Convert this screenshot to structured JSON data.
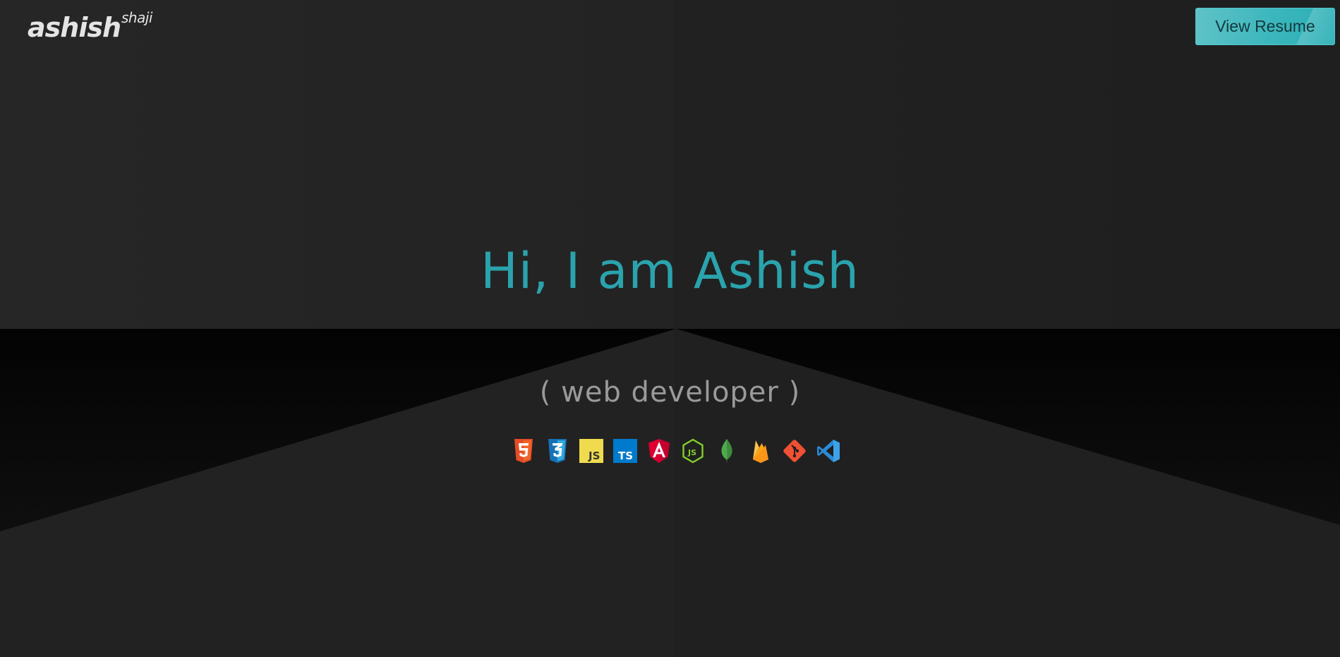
{
  "header": {
    "logo_main": "ashish",
    "logo_sup": "shaji",
    "resume_button_label": "View Resume"
  },
  "hero": {
    "headline": "Hi, I am Ashish",
    "subtitle": "( web developer )"
  },
  "tech_icons": [
    {
      "name": "html5-icon",
      "color": "#e44d26"
    },
    {
      "name": "css3-icon",
      "color": "#1572b6"
    },
    {
      "name": "javascript-icon",
      "color": "#f0db4f"
    },
    {
      "name": "typescript-icon",
      "color": "#007acc"
    },
    {
      "name": "angular-icon",
      "color": "#dd0031"
    },
    {
      "name": "nodejs-icon",
      "color": "#83cd29"
    },
    {
      "name": "mongodb-icon",
      "color": "#4fa94d"
    },
    {
      "name": "firebase-icon",
      "color": "#ffa611"
    },
    {
      "name": "git-icon",
      "color": "#f05033"
    },
    {
      "name": "vscode-icon",
      "color": "#2a8ad4"
    }
  ],
  "colors": {
    "accent": "#2aa3ad",
    "button": "#3bb6bc",
    "background": "#222222"
  }
}
